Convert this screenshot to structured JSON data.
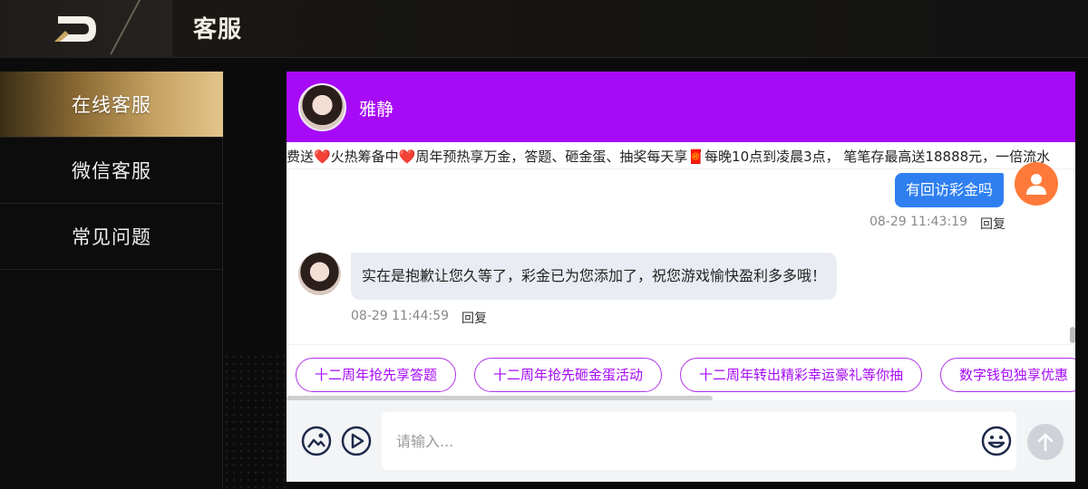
{
  "header": {
    "title": "客服",
    "back_icon": "back-logo-icon"
  },
  "sidebar": {
    "items": [
      {
        "label": "在线客服",
        "active": true
      },
      {
        "label": "微信客服",
        "active": false
      },
      {
        "label": "常见问题",
        "active": false
      }
    ]
  },
  "chat": {
    "header_color": "#a70af7",
    "agent_name": "雅静",
    "marquee": "费送❤️火热筹备中❤️周年预热享万金，答题、砸金蛋、抽奖每天享🧧每晚10点到凌晨3点， 笔笔存最高送18888元，一倍流水",
    "messages": [
      {
        "from": "user",
        "text": "有回访彩金吗",
        "time": "08-29 11:43:19",
        "reply_label": "回复"
      },
      {
        "from": "agent",
        "text": "实在是抱歉让您久等了，彩金已为您添加了，祝您游戏愉快盈利多多哦！",
        "time": "08-29 11:44:59",
        "reply_label": "回复"
      }
    ],
    "quick_replies": [
      "十二周年抢先享答题",
      "十二周年抢先砸金蛋活动",
      "十二周年转出精彩幸运豪礼等你抽",
      "数字钱包独享优惠"
    ],
    "input_placeholder": "请输入..."
  },
  "colors": {
    "accent": "#a70af7",
    "user_bubble": "#2f7ff0",
    "user_avatar": "#ff7a3a",
    "sidebar_active": "#c7a363"
  }
}
